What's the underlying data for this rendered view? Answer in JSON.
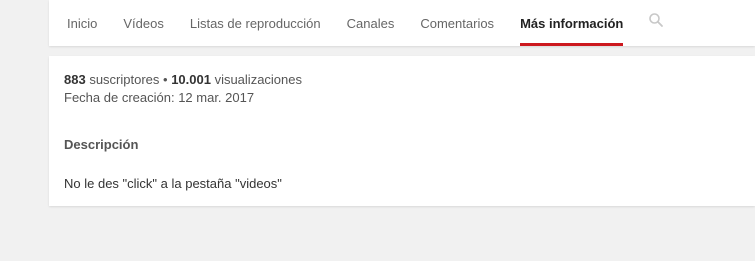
{
  "tabs": [
    {
      "label": "Inicio",
      "active": false
    },
    {
      "label": "Vídeos",
      "active": false
    },
    {
      "label": "Listas de reproducción",
      "active": false
    },
    {
      "label": "Canales",
      "active": false
    },
    {
      "label": "Comentarios",
      "active": false
    },
    {
      "label": "Más información",
      "active": true
    }
  ],
  "search_icon": "search-icon",
  "about": {
    "subscribers_count": "883",
    "subscribers_label": " suscriptores",
    "separator": " • ",
    "views_count": "10.001",
    "views_label": " visualizaciones",
    "created_label": "Fecha de creación: ",
    "created_date": "12 mar. 2017",
    "description_heading": "Descripción",
    "description_text": "No le des \"click\" a la pestaña \"videos\""
  },
  "colors": {
    "active_tab_underline": "#cc181e",
    "page_background": "#f1f1f1"
  }
}
